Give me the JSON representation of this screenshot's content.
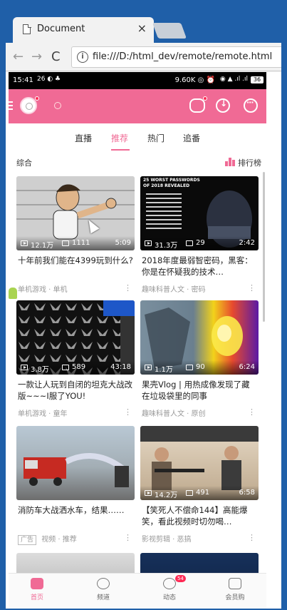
{
  "browser": {
    "tab_title": "Document",
    "tab_close": "×",
    "url": "file:///D:/html_dev/remote/remote.html",
    "back": "←",
    "forward": "→",
    "reload": "C",
    "info": "i"
  },
  "statusbar": {
    "time": "15:41",
    "icons": "26 ◐ ♣",
    "speed": "9.60K ◎ ⏰",
    "signal": "◉ ▲ .ıl .ıl",
    "battery": "36"
  },
  "tabs": [
    {
      "label": "直播"
    },
    {
      "label": "推荐"
    },
    {
      "label": "热门"
    },
    {
      "label": "追番"
    }
  ],
  "subhead": {
    "left": "综合",
    "rank": "排行榜"
  },
  "cards": [
    {
      "views": "12.1万",
      "danmaku": "1111",
      "duration": "5:09",
      "title": "十年前我们能在4399玩到什么?",
      "foot": "单机游戏 · 单机",
      "ad": ""
    },
    {
      "views": "31.3万",
      "danmaku": "29",
      "duration": "2:42",
      "title": "2018年度最弱智密码，黑客：你是在怀疑我的技术…",
      "foot": "趣味科普人文 · 密码",
      "ad": ""
    },
    {
      "views": "3.8万",
      "danmaku": "589",
      "duration": "43:18",
      "title": "一款让人玩到自闭的坦克大战改版~~~I服了YOU!",
      "foot": "单机游戏 · 童年",
      "ad": ""
    },
    {
      "views": "1.1万",
      "danmaku": "90",
      "duration": "6:24",
      "title": "果壳Vlog | 用热成像发现了藏在垃圾袋里的同事",
      "foot": "趣味科普人文 · 原创",
      "ad": ""
    },
    {
      "views": "",
      "danmaku": "",
      "duration": "",
      "title": "消防车大战洒水车，结果……",
      "foot": "视频 · 推荐",
      "ad": "广告"
    },
    {
      "views": "14.2万",
      "danmaku": "491",
      "duration": "6:58",
      "title": "【笑死人不偿命144】高能爆笑，看此视频时切勿喝…",
      "foot": "影视剪辑 · 恶搞",
      "ad": ""
    }
  ],
  "thumb_labels": {
    "passwords": "25 WORST PASSWORDS OF 2018 REVEALED"
  },
  "bottom_nav": [
    {
      "label": "首页"
    },
    {
      "label": "频道"
    },
    {
      "label": "动态",
      "badge": "54"
    },
    {
      "label": "会员购"
    }
  ],
  "more": "⋮",
  "colors": {
    "accent": "#f06a95",
    "browser_frame": "#1f5fa8"
  }
}
